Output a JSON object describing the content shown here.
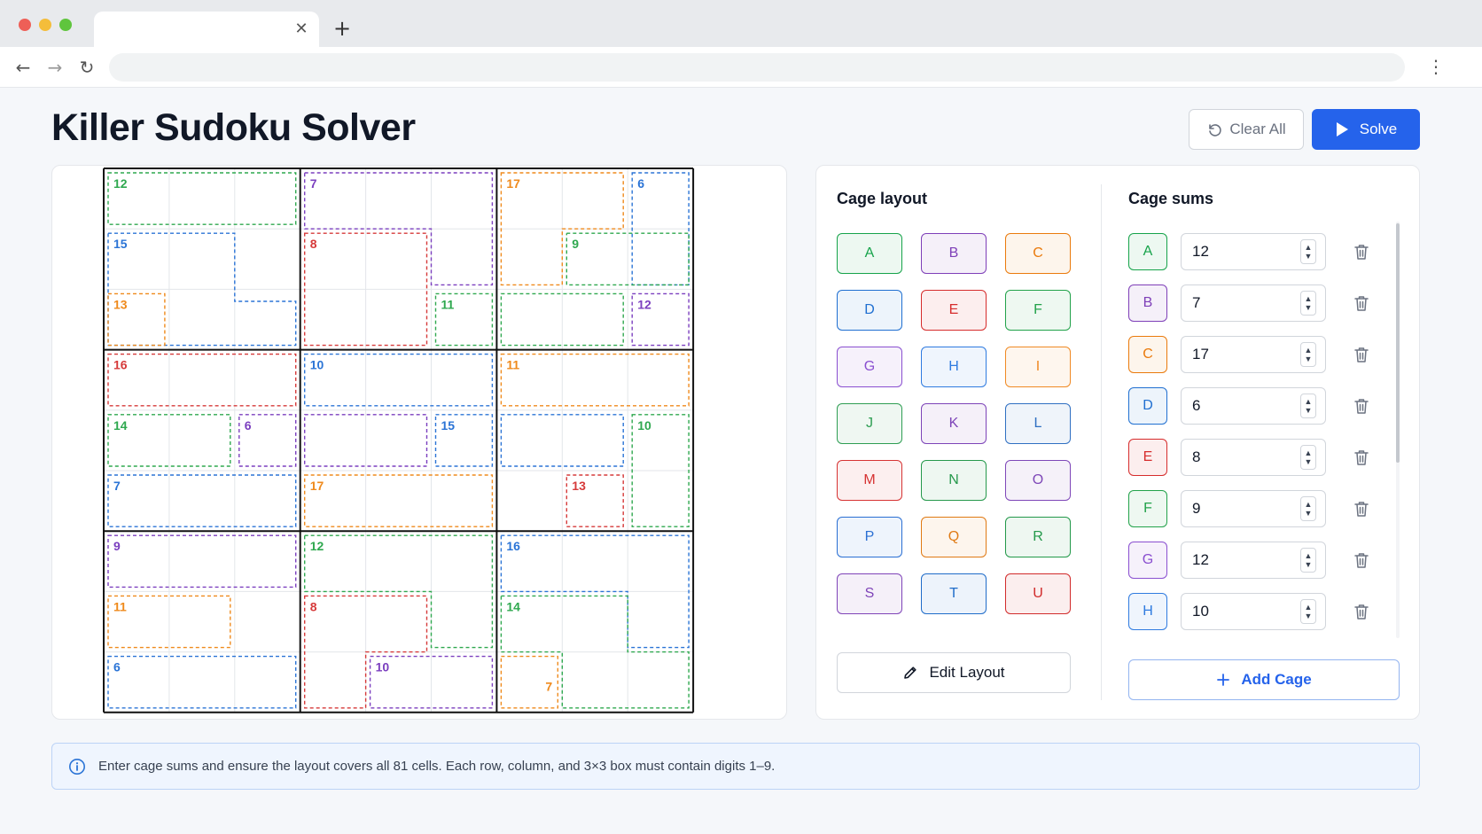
{
  "page": {
    "title": "Killer Sudoku Solver",
    "clear_all_label": "Clear All",
    "solve_label": "Solve"
  },
  "layout_panel": {
    "title": "Cage layout",
    "edit_label": "Edit Layout",
    "cages": [
      {
        "letter": "A",
        "color": "#16a34a"
      },
      {
        "letter": "B",
        "color": "#7e3fb8"
      },
      {
        "letter": "C",
        "color": "#ea7a0c"
      },
      {
        "letter": "D",
        "color": "#1f6fd1"
      },
      {
        "letter": "E",
        "color": "#d62c2c"
      },
      {
        "letter": "F",
        "color": "#22a24a"
      },
      {
        "letter": "G",
        "color": "#8a4fd0"
      },
      {
        "letter": "H",
        "color": "#2f7be0"
      },
      {
        "letter": "I",
        "color": "#f08a24"
      },
      {
        "letter": "J",
        "color": "#2e9e53"
      },
      {
        "letter": "K",
        "color": "#7d44b8"
      },
      {
        "letter": "L",
        "color": "#2f6fc2"
      },
      {
        "letter": "M",
        "color": "#d63333"
      },
      {
        "letter": "N",
        "color": "#26994c"
      },
      {
        "letter": "O",
        "color": "#7e47b8"
      },
      {
        "letter": "P",
        "color": "#2a6fd3"
      },
      {
        "letter": "Q",
        "color": "#e07a14"
      },
      {
        "letter": "R",
        "color": "#23994a"
      },
      {
        "letter": "S",
        "color": "#7f44b8"
      },
      {
        "letter": "T",
        "color": "#1f6cc9"
      },
      {
        "letter": "U",
        "color": "#d12b2b"
      }
    ]
  },
  "sums_panel": {
    "title": "Cage sums",
    "add_label": "Add Cage",
    "rows": [
      {
        "letter": "A",
        "value": "12",
        "color": "#16a34a"
      },
      {
        "letter": "B",
        "value": "7",
        "color": "#7e3fb8"
      },
      {
        "letter": "C",
        "value": "17",
        "color": "#ea7a0c"
      },
      {
        "letter": "D",
        "value": "6",
        "color": "#1f6fd1"
      },
      {
        "letter": "E",
        "value": "8",
        "color": "#d62c2c"
      },
      {
        "letter": "F",
        "value": "9",
        "color": "#22a24a"
      },
      {
        "letter": "G",
        "value": "12",
        "color": "#8a4fd0"
      },
      {
        "letter": "H",
        "value": "10",
        "color": "#2f7be0"
      }
    ]
  },
  "board": {
    "colors": {
      "green": "#2fa84f",
      "purple": "#7b3fbf",
      "orange": "#ef8a1c",
      "blue": "#2b74d6",
      "red": "#d63a3a"
    },
    "cage_labels": [
      {
        "text": "12",
        "color": "green"
      },
      {
        "text": "7",
        "color": "purple"
      },
      {
        "text": "17",
        "color": "orange"
      },
      {
        "text": "6",
        "color": "blue"
      },
      {
        "text": "15",
        "color": "blue"
      },
      {
        "text": "8",
        "color": "red"
      },
      {
        "text": "9",
        "color": "green"
      },
      {
        "text": "13",
        "color": "orange"
      },
      {
        "text": "11",
        "color": "green"
      },
      {
        "text": "12",
        "color": "purple"
      },
      {
        "text": "16",
        "color": "red"
      },
      {
        "text": "10",
        "color": "blue"
      },
      {
        "text": "11",
        "color": "orange"
      },
      {
        "text": "14",
        "color": "green"
      },
      {
        "text": "6",
        "color": "purple"
      },
      {
        "text": "15",
        "color": "blue"
      },
      {
        "text": "10",
        "color": "green"
      },
      {
        "text": "7",
        "color": "blue"
      },
      {
        "text": "17",
        "color": "orange"
      },
      {
        "text": "13",
        "color": "red"
      },
      {
        "text": "9",
        "color": "purple"
      },
      {
        "text": "12",
        "color": "green"
      },
      {
        "text": "16",
        "color": "blue"
      },
      {
        "text": "11",
        "color": "orange"
      },
      {
        "text": "8",
        "color": "red"
      },
      {
        "text": "14",
        "color": "green"
      },
      {
        "text": "6",
        "color": "blue"
      },
      {
        "text": "10",
        "color": "purple"
      },
      {
        "text": "7",
        "color": "orange"
      }
    ]
  },
  "info": {
    "text": "Enter cage sums and ensure the layout covers all 81 cells. Each row, column, and 3×3 box must contain digits 1–9."
  },
  "icons": [
    "info-icon",
    "undo-icon",
    "play-icon",
    "pencil-icon",
    "plus-icon",
    "trash-icon"
  ]
}
